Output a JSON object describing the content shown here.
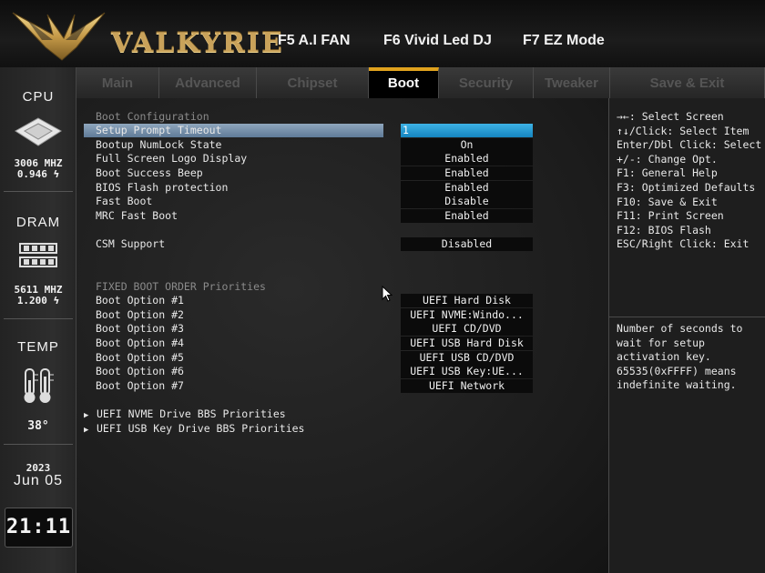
{
  "header": {
    "brand": "VALKYRIE",
    "hotkeys": [
      "F5 A.I FAN",
      "F6 Vivid Led DJ",
      "F7 EZ Mode"
    ]
  },
  "rail": {
    "cpu": {
      "title": "CPU",
      "freq": "3006 MHZ",
      "volt": "0.946"
    },
    "dram": {
      "title": "DRAM",
      "freq": "5611 MHZ",
      "volt": "1.200"
    },
    "temp": {
      "title": "TEMP",
      "value": "38°"
    },
    "date": {
      "year": "2023",
      "day": "Jun 05"
    },
    "clock": "21:11"
  },
  "tabs": [
    {
      "label": "Main",
      "active": false
    },
    {
      "label": "Advanced",
      "active": false
    },
    {
      "label": "Chipset",
      "active": false
    },
    {
      "label": "Boot",
      "active": true
    },
    {
      "label": "Security",
      "active": false
    },
    {
      "label": "Tweaker",
      "active": false
    },
    {
      "label": "Save & Exit",
      "active": false
    }
  ],
  "boot": {
    "section_config": "Boot Configuration",
    "settings": [
      {
        "label": "Setup Prompt Timeout",
        "value": "1"
      },
      {
        "label": "Bootup NumLock State",
        "value": "On"
      },
      {
        "label": "Full Screen Logo Display",
        "value": "Enabled"
      },
      {
        "label": "Boot Success Beep",
        "value": "Enabled"
      },
      {
        "label": "BIOS Flash protection",
        "value": "Enabled"
      },
      {
        "label": "Fast Boot",
        "value": "Disable"
      },
      {
        "label": "MRC Fast Boot",
        "value": "Enabled"
      }
    ],
    "csm": {
      "label": "CSM Support",
      "value": "Disabled"
    },
    "section_order": "FIXED BOOT ORDER Priorities",
    "boot_options": [
      {
        "label": "Boot Option #1",
        "value": "UEFI Hard Disk"
      },
      {
        "label": "Boot Option #2",
        "value": "UEFI NVME:Windo..."
      },
      {
        "label": "Boot Option #3",
        "value": "UEFI CD/DVD"
      },
      {
        "label": "Boot Option #4",
        "value": "UEFI USB Hard Disk"
      },
      {
        "label": "Boot Option #5",
        "value": "UEFI USB CD/DVD"
      },
      {
        "label": "Boot Option #6",
        "value": "UEFI USB Key:UE..."
      },
      {
        "label": "Boot Option #7",
        "value": "UEFI Network"
      }
    ],
    "submenus": [
      "UEFI NVME Drive BBS Priorities",
      "UEFI USB Key Drive BBS Priorities"
    ]
  },
  "help": {
    "keys": [
      "→←: Select Screen",
      "↑↓/Click: Select Item",
      "Enter/Dbl Click: Select",
      "+/-: Change Opt.",
      "F1: General Help",
      "F3: Optimized Defaults",
      "F10: Save & Exit",
      "F11: Print Screen",
      "F12: BIOS Flash",
      "ESC/Right Click: Exit"
    ],
    "description": [
      "Number of seconds to",
      "wait for setup",
      "activation key.",
      "65535(0xFFFF) means",
      "indefinite waiting."
    ]
  },
  "colors": {
    "accent": "#e0a21e",
    "brand_gold": "#c9a25a",
    "selected_value": "#1e9ad6"
  }
}
